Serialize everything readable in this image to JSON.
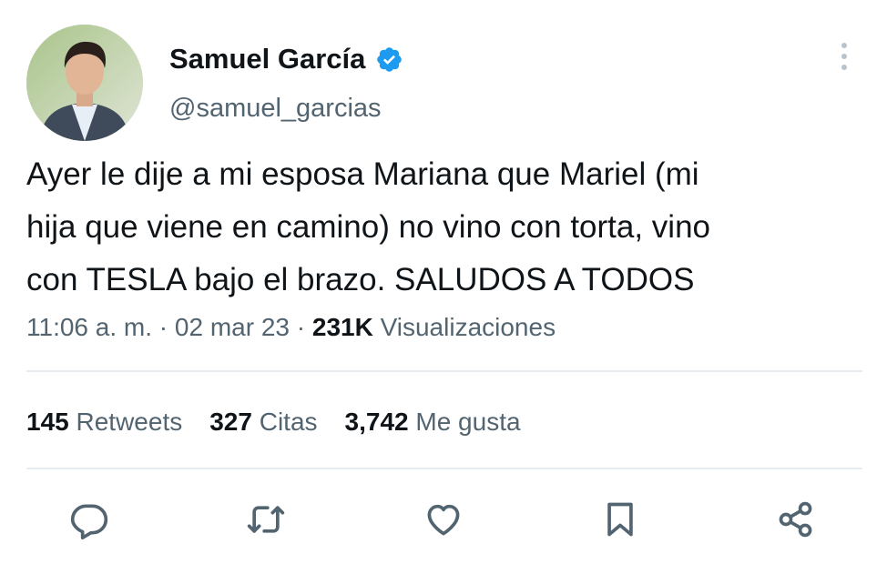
{
  "author": {
    "display_name": "Samuel García",
    "handle": "@samuel_garcias",
    "verified_color": "#1d9bf0"
  },
  "tweet": {
    "lines": [
      "Ayer le dije a mi esposa Mariana que Mariel (mi",
      "hija que viene en camino) no vino con torta, vino",
      "con TESLA bajo el brazo. SALUDOS A TODOS"
    ],
    "time": "11:06 a. m.",
    "date": "02 mar 23",
    "separator": "·",
    "views_count": "231K",
    "views_label": "Visualizaciones"
  },
  "stats": {
    "retweets_count": "145",
    "retweets_label": "Retweets",
    "quotes_count": "327",
    "quotes_label": "Citas",
    "likes_count": "3,742",
    "likes_label": "Me gusta"
  },
  "actions": [
    {
      "icon": "reply-icon"
    },
    {
      "icon": "retweet-icon"
    },
    {
      "icon": "like-icon"
    },
    {
      "icon": "bookmark-icon"
    },
    {
      "icon": "share-icon"
    }
  ],
  "colors": {
    "text": "#0f1419",
    "secondary": "#536471",
    "divider": "#e6ecf0",
    "icon": "#536471"
  }
}
